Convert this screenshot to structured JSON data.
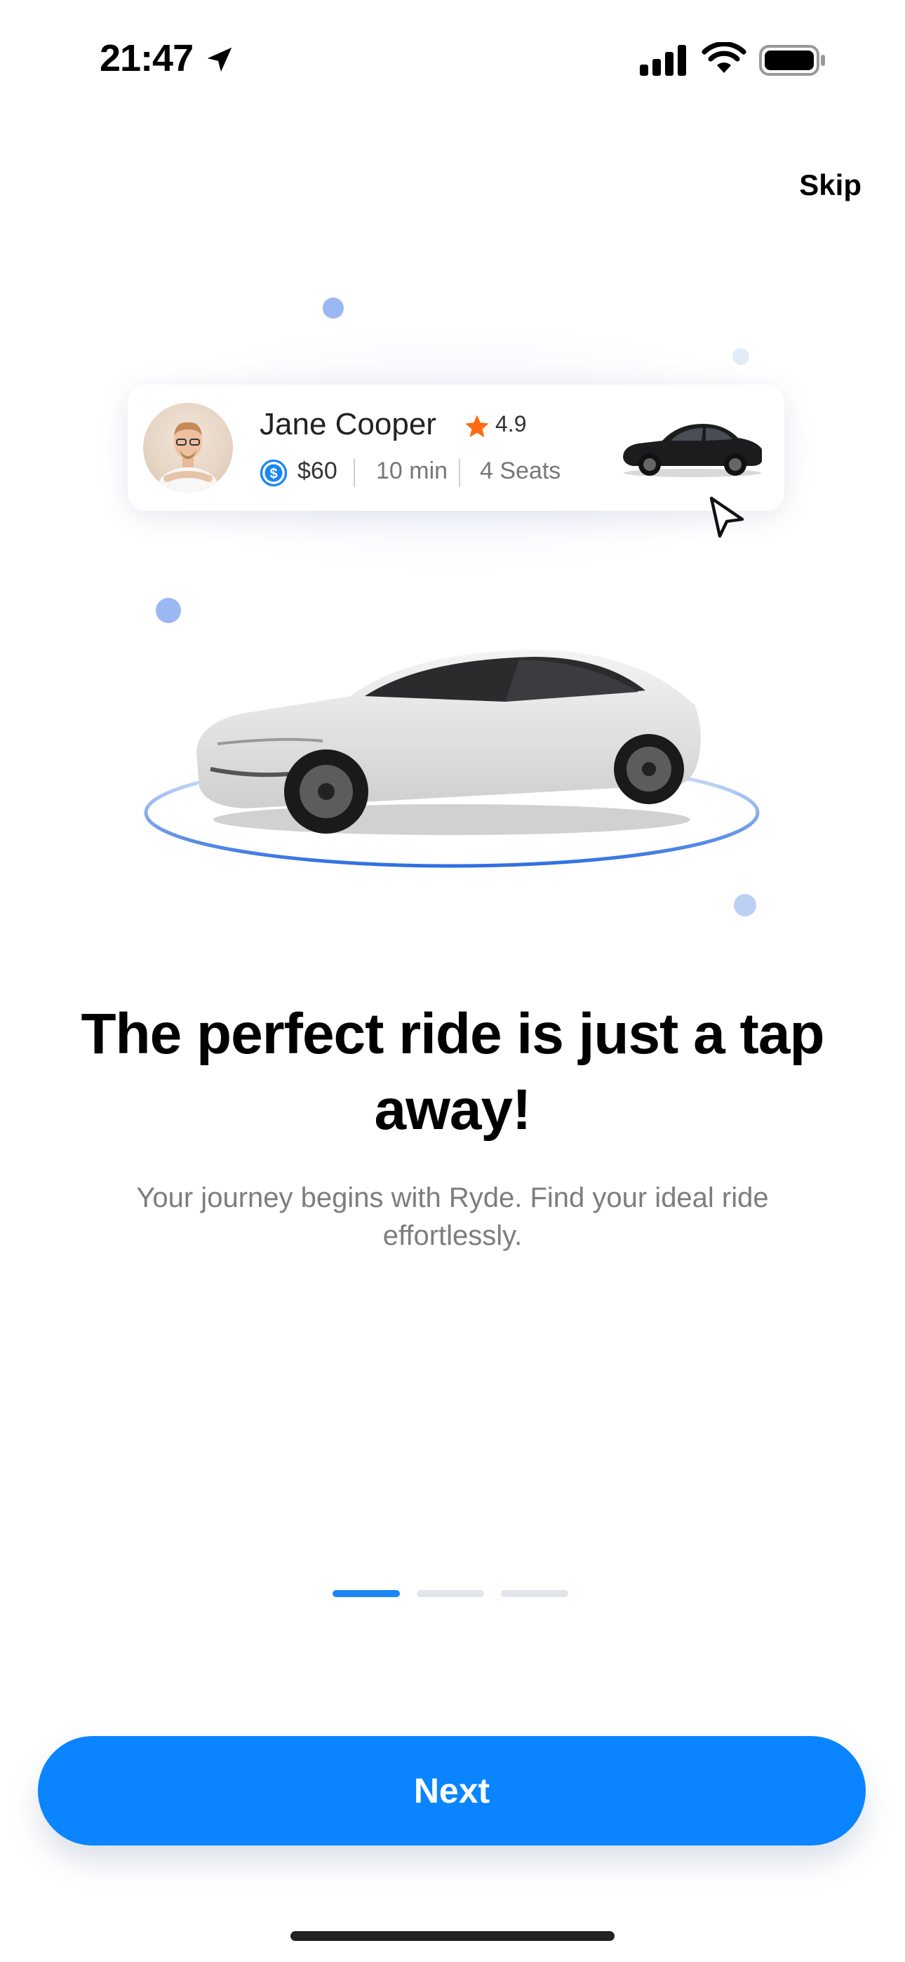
{
  "status_bar": {
    "time": "21:47",
    "icons": [
      "location-arrow-icon",
      "signal-icon",
      "wifi-icon",
      "battery-icon"
    ]
  },
  "header": {
    "skip_label": "Skip"
  },
  "ride_card": {
    "driver_name": "Jane Cooper",
    "rating": "4.9",
    "price": "$60",
    "duration": "10 min",
    "seats": "4 Seats"
  },
  "onboarding": {
    "title": "The perfect ride is just a tap away!",
    "subtitle": "Your journey begins with Ryde. Find your ideal ride effortlessly.",
    "page_count": 3,
    "active_page": 1
  },
  "footer": {
    "next_label": "Next"
  },
  "colors": {
    "accent": "#0a84ff",
    "star": "#ff6a13",
    "dot": "#9bb8f2"
  }
}
